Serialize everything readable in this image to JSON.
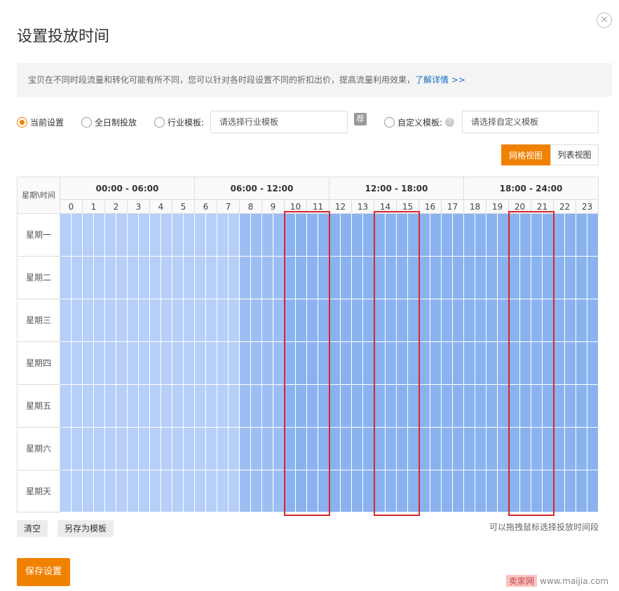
{
  "dialog": {
    "title": "设置投放时间",
    "close_glyph": "×"
  },
  "notice": {
    "text": "宝贝在不同时段流量和转化可能有所不同，您可以针对各时段设置不同的折扣出价，提高流量利用效果，",
    "link": "了解详情 >>"
  },
  "options": {
    "current": "当前设置",
    "all_day": "全日制投放",
    "industry_label": "行业模板:",
    "industry_placeholder": "请选择行业模板",
    "recommend_badge": "荐",
    "custom_label": "自定义模板:",
    "custom_placeholder": "请选择自定义模板",
    "help_glyph": "?",
    "selected": "current"
  },
  "view": {
    "grid_label": "网格视图",
    "list_label": "列表视图",
    "active": "grid"
  },
  "schedule": {
    "corner_label": "星期\\时间",
    "ranges": [
      "00:00 - 06:00",
      "06:00 - 12:00",
      "12:00 - 18:00",
      "18:00 - 24:00"
    ],
    "hours": [
      "0",
      "1",
      "2",
      "3",
      "4",
      "5",
      "6",
      "7",
      "8",
      "9",
      "10",
      "11",
      "12",
      "13",
      "14",
      "15",
      "16",
      "17",
      "18",
      "19",
      "20",
      "21",
      "22",
      "23"
    ],
    "days": [
      "星期一",
      "星期二",
      "星期三",
      "星期四",
      "星期五",
      "星期六",
      "星期天"
    ],
    "hour_discount_level": [
      1,
      1,
      1,
      1,
      1,
      1,
      1,
      1,
      2,
      2,
      3,
      3,
      3,
      3,
      3,
      3,
      3,
      3,
      3,
      3,
      3,
      3,
      3,
      3
    ],
    "level_colors": {
      "1": "#b5cff8",
      "2": "#9dbef3",
      "3": "#8ab2ef"
    },
    "highlight_color": "#d9262f",
    "highlighted_hour_ranges": [
      [
        10,
        11
      ],
      [
        14,
        15
      ],
      [
        20,
        21
      ]
    ]
  },
  "footer": {
    "clear": "清空",
    "save_as_template": "另存为模板",
    "drag_hint": "可以拖拽鼠标选择投放时间段",
    "save": "保存设置"
  },
  "watermark": {
    "logo": "卖家网",
    "url": "www.maijia.com"
  }
}
